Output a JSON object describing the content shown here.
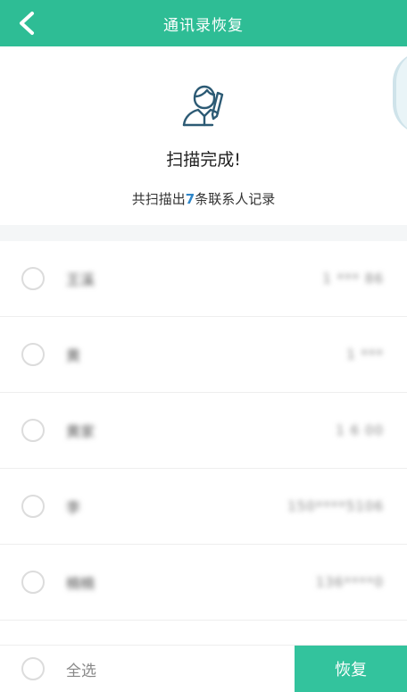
{
  "header": {
    "title": "通讯录恢复",
    "back_icon": "chevron-left-icon"
  },
  "summary": {
    "icon": "person-edit-icon",
    "status": "扫描完成!",
    "count_prefix": "共扫描出",
    "count": "7",
    "count_suffix": "条联系人记录"
  },
  "contacts": [
    {
      "name": "王溪",
      "phone": "1  *** 86"
    },
    {
      "name": "黄 ",
      "phone": "1  ***   "
    },
    {
      "name": "黄家 ",
      "phone": "1 6    00  "
    },
    {
      "name": "李 ",
      "phone": "150****5106"
    },
    {
      "name": "楠楠",
      "phone": "136****0"
    }
  ],
  "footer": {
    "select_all": "全选",
    "restore": "恢复"
  },
  "colors": {
    "accent": "#2ebd95",
    "count_highlight": "#2f86c8"
  }
}
